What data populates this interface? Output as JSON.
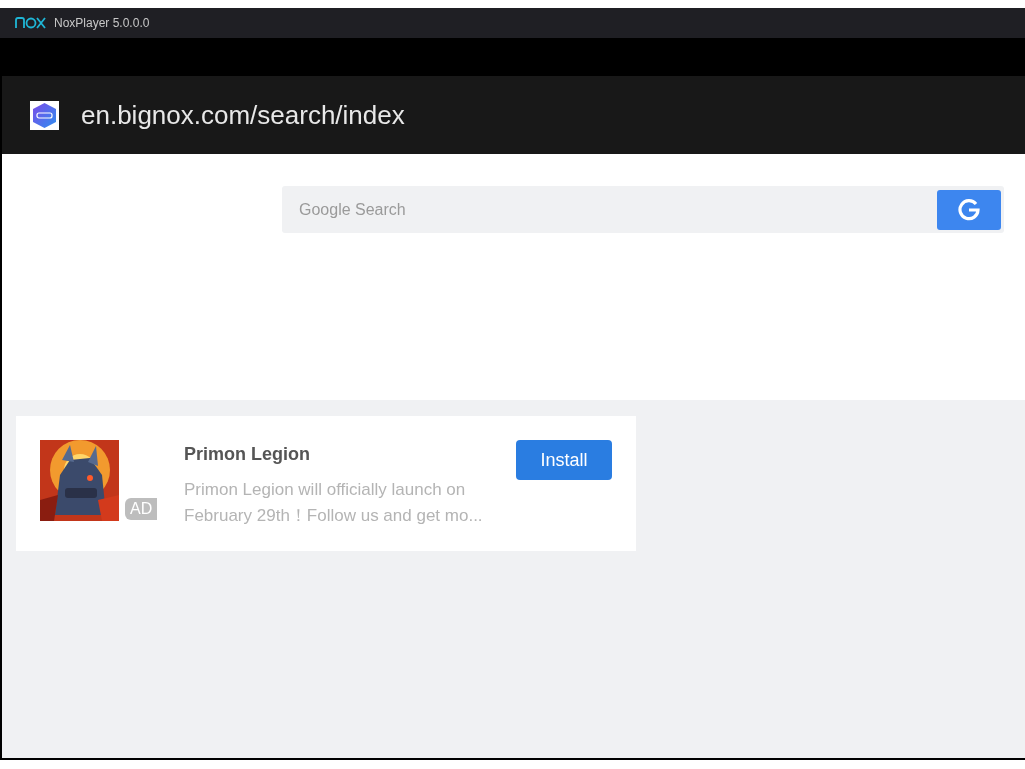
{
  "window": {
    "title": "NoxPlayer 5.0.0.0"
  },
  "address_bar": {
    "url": "en.bignox.com/search/index"
  },
  "search": {
    "placeholder": "Google Search"
  },
  "ad_card": {
    "badge": "AD",
    "title": "Primon Legion",
    "description": "Primon Legion will officially launch on February 29th！Follow us and get mo...",
    "button": "Install"
  }
}
